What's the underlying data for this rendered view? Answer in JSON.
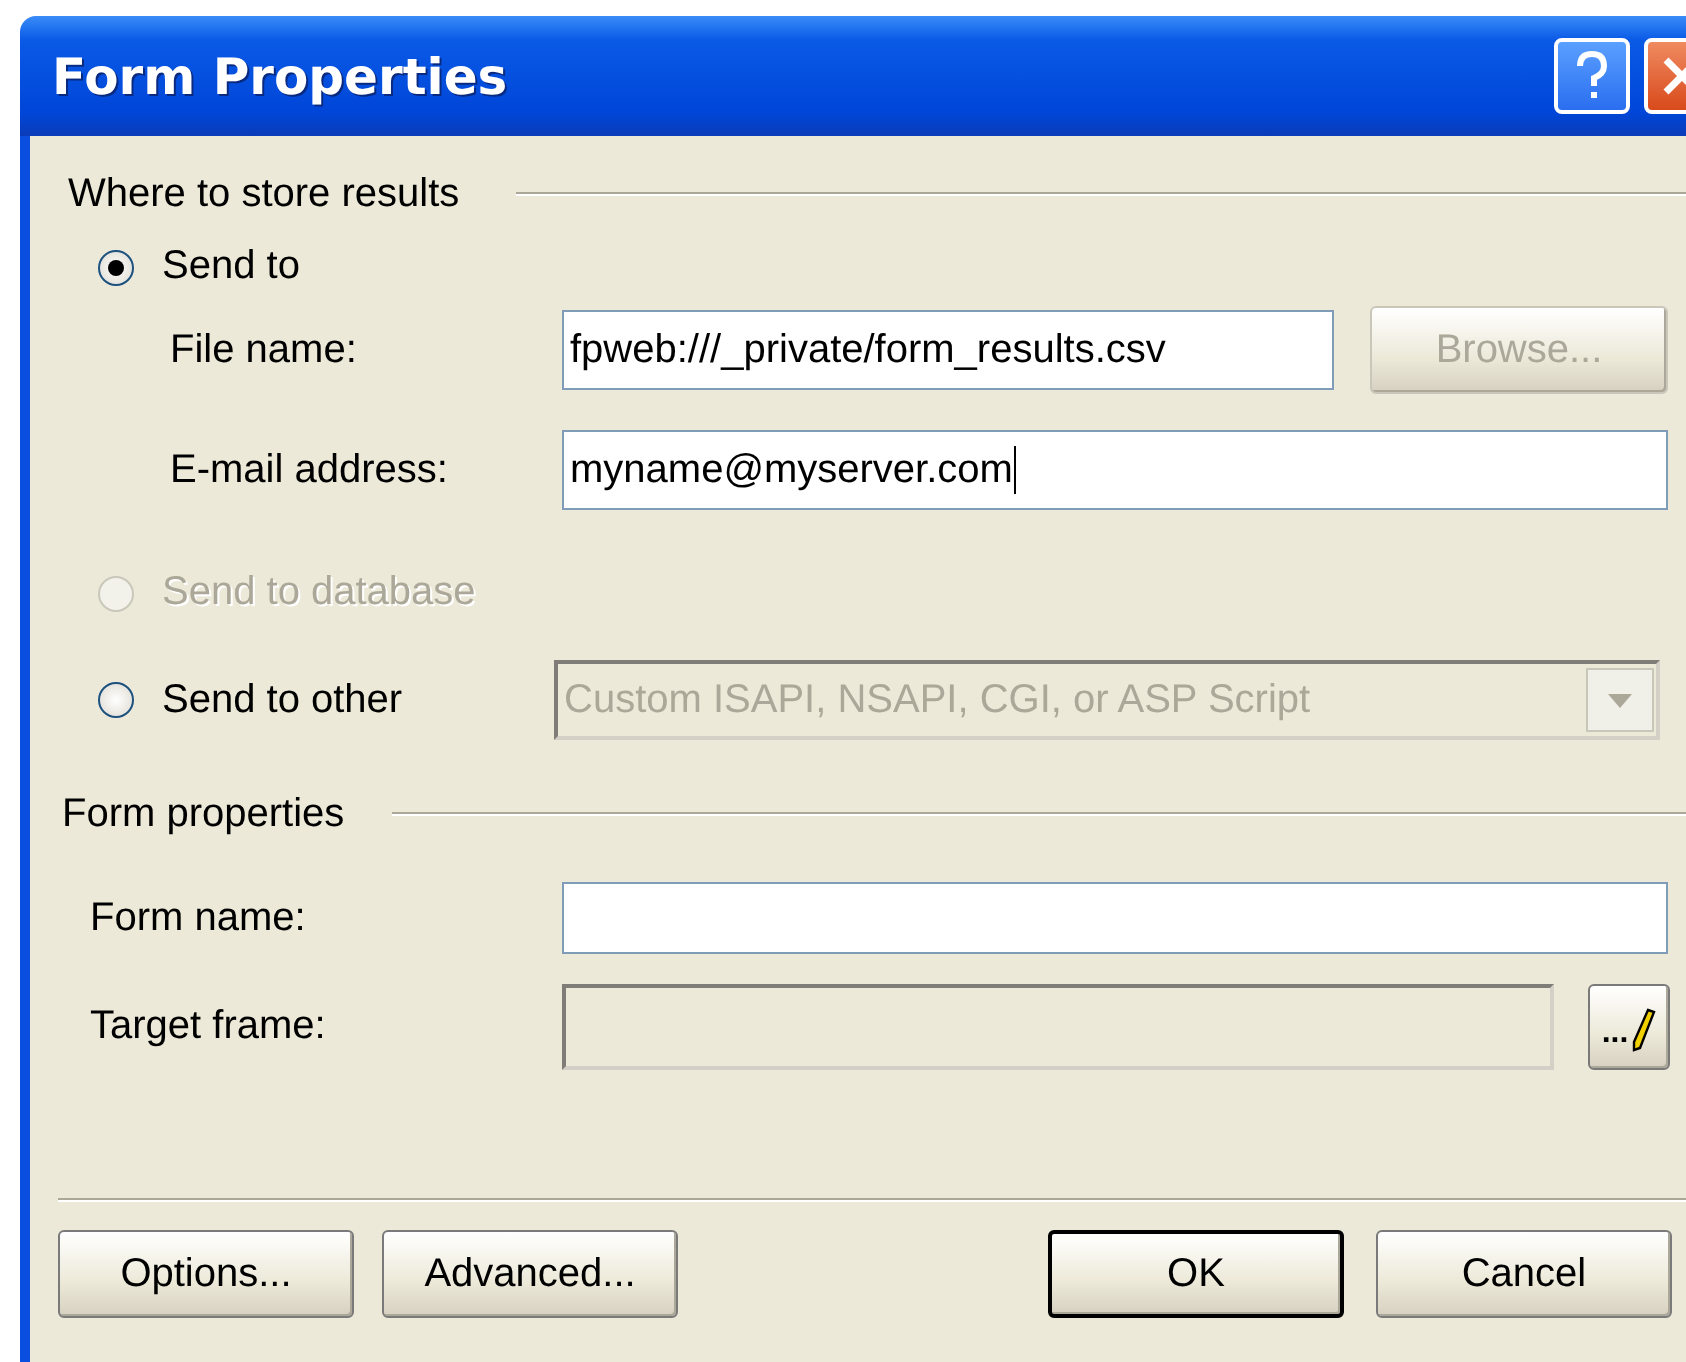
{
  "window": {
    "title": "Form Properties"
  },
  "results": {
    "heading": "Where to store results",
    "destinations": [
      {
        "kind": "send_to",
        "label": "Send to",
        "selected": true,
        "disabled": false,
        "fields": [
          {
            "label": "File name:",
            "value": "fpweb:///_private/form_results.csv",
            "button": {
              "label": "Browse...",
              "disabled": true
            }
          },
          {
            "label": "E-mail address:",
            "value": "myname@myserver.com",
            "focused": true
          }
        ]
      },
      {
        "kind": "database",
        "label": "Send to database",
        "selected": false,
        "disabled": true
      },
      {
        "kind": "other",
        "label": "Send to other",
        "selected": false,
        "disabled": false,
        "combo": {
          "value": "Custom ISAPI, NSAPI, CGI, or ASP Script",
          "disabled": true
        }
      }
    ]
  },
  "form": {
    "heading": "Form properties",
    "fields": [
      {
        "label": "Form name:",
        "disabled": false
      },
      {
        "label": "Target frame:",
        "disabled": true,
        "button": {
          "label": "..."
        }
      }
    ]
  },
  "left_buttons": [
    {
      "label": "Options...",
      "default": false
    },
    {
      "label": "Advanced...",
      "default": false
    }
  ],
  "right_buttons": [
    {
      "label": "OK",
      "default": true
    },
    {
      "label": "Cancel",
      "default": false
    }
  ]
}
